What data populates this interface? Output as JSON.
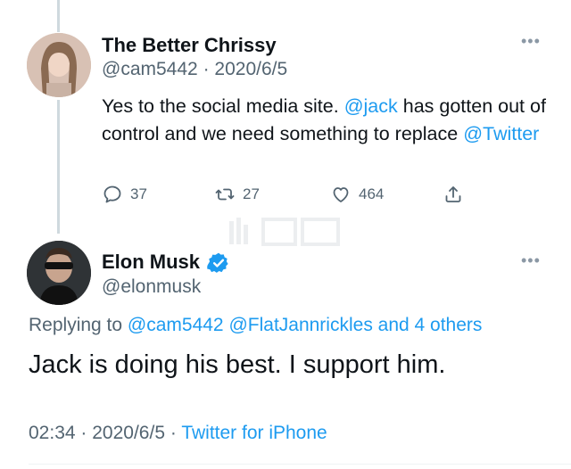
{
  "parent_tweet": {
    "author_name": "The Better Chrissy",
    "handle": "@cam5442",
    "separator": "·",
    "date": "2020/6/5",
    "text_1": "Yes to the social media site. ",
    "mention_jack": "@jack",
    "text_2": " has gotten out of control and we need something to replace ",
    "mention_twitter": "@Twitter",
    "more_icon": "more-dots-icon",
    "actions": {
      "reply_count": "37",
      "retweet_count": "27",
      "like_count": "464"
    }
  },
  "main_tweet": {
    "author_name": "Elon Musk",
    "handle": "@elonmusk",
    "verified_icon": "verified-badge-icon",
    "replying_prefix": "Replying to ",
    "reply_mentions": "@cam5442 @FlatJannrickles and 4 others",
    "text": "Jack is doing his best. I support him.",
    "time": "02:34",
    "separator": "·",
    "date": "2020/6/5",
    "source": "Twitter for iPhone"
  },
  "colors": {
    "link": "#1d9bf0",
    "secondary": "#536471",
    "thread_line": "#cfd9de",
    "verified": "#1d9bf0"
  }
}
